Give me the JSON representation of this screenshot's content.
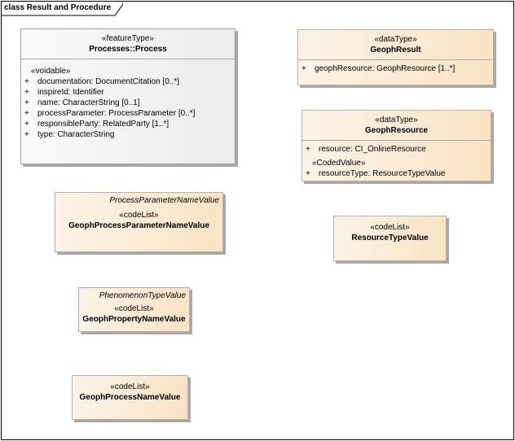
{
  "frame": {
    "title": "class Result and Procedure"
  },
  "classes": {
    "process": {
      "stereotype": "«featureType»",
      "name": "Processes::Process",
      "group": "«voidable»",
      "attributes": [
        {
          "vis": "+",
          "text": "documentation: DocumentCitation [0..*]"
        },
        {
          "vis": "+",
          "text": "inspireId: Identifier"
        },
        {
          "vis": "+",
          "text": "name: CharacterString [0..1]"
        },
        {
          "vis": "+",
          "text": "processParameter: ProcessParameter [0..*]"
        },
        {
          "vis": "+",
          "text": "responsibleParty: RelatedParty [1..*]"
        },
        {
          "vis": "+",
          "text": "type: CharacterString"
        }
      ]
    },
    "geophResult": {
      "stereotype": "«dataType»",
      "name": "GeophResult",
      "attributes": [
        {
          "vis": "+",
          "text": "geophResource: GeophResource [1..*]"
        }
      ]
    },
    "geophResource": {
      "stereotype": "«dataType»",
      "name": "GeophResource",
      "attributes": [
        {
          "vis": "+",
          "text": "resource: CI_OnlineResource"
        }
      ],
      "group": "«CodedValue»",
      "group_attributes": [
        {
          "vis": "+",
          "text": "resourceType: ResourceTypeValue"
        }
      ]
    },
    "geophProcessParameterNameValue": {
      "parent": "ProcessParameterNameValue",
      "stereotype": "«codeList»",
      "name": "GeophProcessParameterNameValue"
    },
    "resourceTypeValue": {
      "stereotype": "«codeList»",
      "name": "ResourceTypeValue"
    },
    "geophPropertyNameValue": {
      "parent": "PhenomenonTypeValue",
      "stereotype": "«codeList»",
      "name": "GeophPropertyNameValue"
    },
    "geophProcessNameValue": {
      "stereotype": "«codeList»",
      "name": "GeophProcessNameValue"
    }
  }
}
